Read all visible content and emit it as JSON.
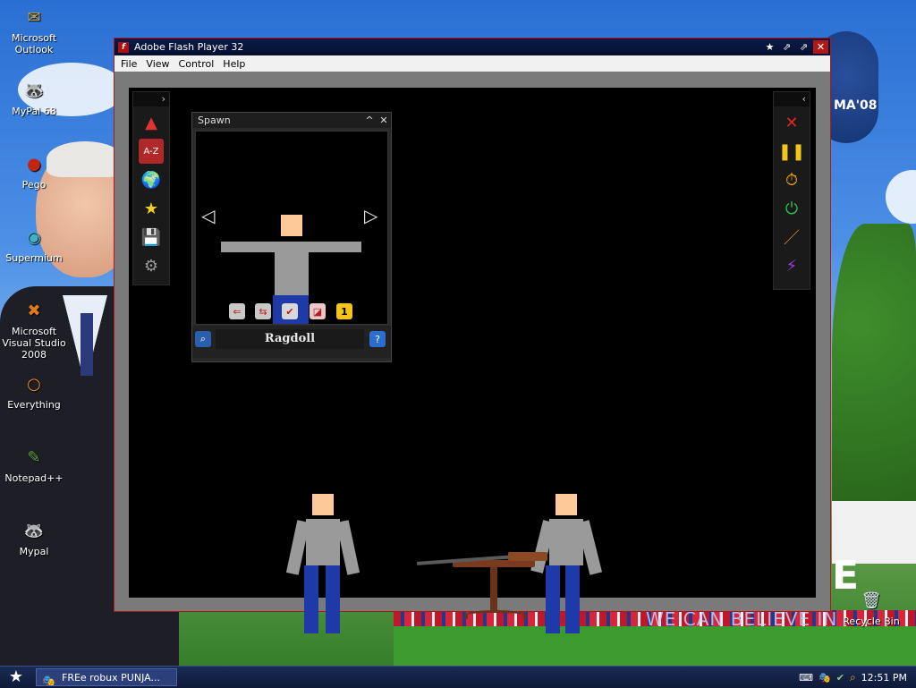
{
  "desktop": {
    "icons": [
      {
        "label": "Microsoft Outlook",
        "glyph": "✉",
        "color": "#c9a22a"
      },
      {
        "label": "MyPal 68",
        "glyph": "🦝",
        "color": "#6b4a2a"
      },
      {
        "label": "Pego",
        "glyph": "●",
        "color": "#c4250f"
      },
      {
        "label": "Supermium",
        "glyph": "◉",
        "color": "#3fb3c6"
      },
      {
        "label": "Microsoft Visual Studio 2008",
        "glyph": "✖",
        "color": "#e07a1a"
      },
      {
        "label": "Everything",
        "glyph": "○",
        "color": "#f08a18"
      },
      {
        "label": "Notepad++",
        "glyph": "✎",
        "color": "#5fa63a"
      },
      {
        "label": "Mypal",
        "glyph": "🦝",
        "color": "#6b4a2a"
      }
    ],
    "recycle_bin": {
      "label": "Recycle Bin",
      "glyph": "🗑"
    },
    "wallpaper_text": {
      "obama": "MA'08",
      "slogan": "WE CAN BELIEVE IN",
      "big_letter": "E"
    }
  },
  "window": {
    "title": "Adobe Flash Player 32",
    "menu": [
      "File",
      "View",
      "Control",
      "Help"
    ],
    "title_buttons": [
      "★",
      "⇗",
      "⇗",
      "✕"
    ]
  },
  "left_toolbar": {
    "collapse": "›",
    "items": [
      {
        "name": "shapes",
        "glyph": "▲",
        "color": "#e03333"
      },
      {
        "name": "a-z",
        "glyph": "A-Z",
        "color": "#c73030"
      },
      {
        "name": "world",
        "glyph": "🌍",
        "color": "#2a9b3a"
      },
      {
        "name": "favorites",
        "glyph": "★",
        "color": "#f5d020"
      },
      {
        "name": "save",
        "glyph": "💾",
        "color": "#4a7ad0"
      },
      {
        "name": "settings",
        "glyph": "⚙",
        "color": "#9a9a9a"
      }
    ]
  },
  "right_toolbar": {
    "collapse": "‹",
    "items": [
      {
        "name": "delete",
        "glyph": "✕",
        "color": "#e02424"
      },
      {
        "name": "pause",
        "glyph": "❚❚",
        "color": "#f3c51a"
      },
      {
        "name": "timer",
        "glyph": "⏱",
        "color": "#f3a51a"
      },
      {
        "name": "power",
        "glyph": "⏻",
        "color": "#2ec24a"
      },
      {
        "name": "knife",
        "glyph": "／",
        "color": "#d88a3a"
      },
      {
        "name": "lightning",
        "glyph": "⚡",
        "color": "#9a3ad8"
      }
    ]
  },
  "spawn_panel": {
    "title": "Spawn",
    "minimize": "^",
    "close": "✕",
    "prev": "◁",
    "next": "▷",
    "item_name": "Ragdoll",
    "option_badge": "1"
  },
  "taskbar": {
    "start_glyph": "★",
    "task_label": "FREe robux PUNJA...",
    "clock": "12:51 PM"
  }
}
